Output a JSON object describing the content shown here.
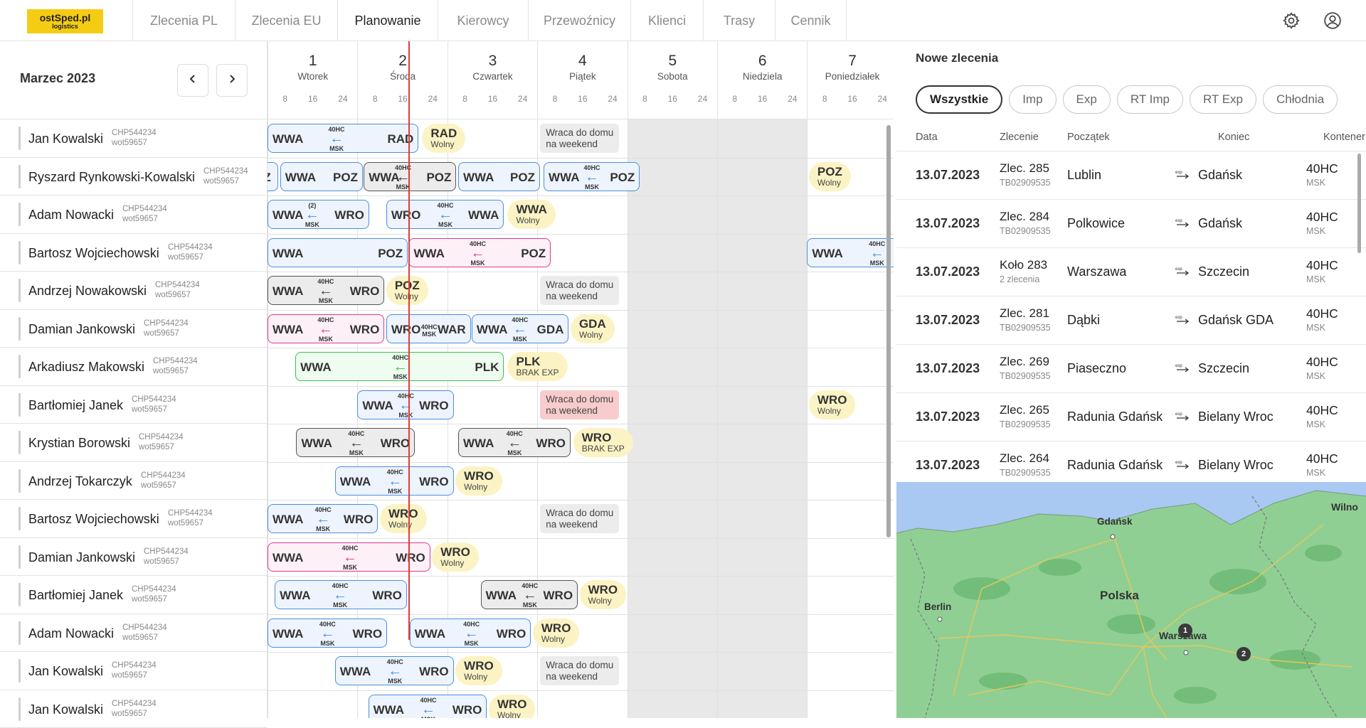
{
  "logo": {
    "line1": "ostSped.pl",
    "line2": "logistics"
  },
  "nav": [
    {
      "label": "Zlecenia PL",
      "w": 144
    },
    {
      "label": "Zlecenia EU",
      "w": 144
    },
    {
      "label": "Planowanie",
      "w": 141
    },
    {
      "label": "Kierowcy",
      "w": 127
    },
    {
      "label": "Przewoźnicy",
      "w": 144
    },
    {
      "label": "Klienci",
      "w": 102
    },
    {
      "label": "Trasy",
      "w": 101
    },
    {
      "label": "Cennik",
      "w": 101
    }
  ],
  "nav_active": "Planowanie",
  "calendar": {
    "month": "Marzec 2023",
    "hours": [
      "8",
      "16",
      "24"
    ],
    "days": [
      {
        "num": "1",
        "name": "Wtorek"
      },
      {
        "num": "2",
        "name": "Środa"
      },
      {
        "num": "3",
        "name": "Czwartek"
      },
      {
        "num": "4",
        "name": "Piątek"
      },
      {
        "num": "5",
        "name": "Sobota"
      },
      {
        "num": "6",
        "name": "Niedziela"
      },
      {
        "num": "7",
        "name": "Poniedziałek"
      }
    ]
  },
  "drivers": [
    {
      "name": "Jan Kowalski",
      "code": "CHP544234",
      "id": "wot59657"
    },
    {
      "name": "Ryszard Rynkowski-Kowalski",
      "code": "CHP544234",
      "id": "wot59657"
    },
    {
      "name": "Adam Nowacki",
      "code": "CHP544234",
      "id": "wot59657"
    },
    {
      "name": "Bartosz Wojciechowski",
      "code": "CHP544234",
      "id": "wot59657"
    },
    {
      "name": "Andrzej Nowakowski",
      "code": "CHP544234",
      "id": "wot59657"
    },
    {
      "name": "Damian Jankowski",
      "code": "CHP544234",
      "id": "wot59657"
    },
    {
      "name": "Arkadiusz Makowski",
      "code": "CHP544234",
      "id": "wot59657"
    },
    {
      "name": "Bartłomiej Janek",
      "code": "CHP544234",
      "id": "wot59657"
    },
    {
      "name": "Krystian Borowski",
      "code": "CHP544234",
      "id": "wot59657"
    },
    {
      "name": "Andrzej Tokarczyk",
      "code": "CHP544234",
      "id": "wot59657"
    },
    {
      "name": "Bartosz Wojciechowski",
      "code": "CHP544234",
      "id": "wot59657"
    },
    {
      "name": "Damian Jankowski",
      "code": "CHP544234",
      "id": "wot59657"
    },
    {
      "name": "Bartłomiej Janek",
      "code": "CHP544234",
      "id": "wot59657"
    },
    {
      "name": "Adam Nowacki",
      "code": "CHP544234",
      "id": "wot59657"
    },
    {
      "name": "Jan Kowalski",
      "code": "CHP544234",
      "id": "wot59657"
    },
    {
      "name": "Jan Kowalski",
      "code": "CHP544234",
      "id": "wot59657"
    }
  ],
  "trip_labels": {
    "container": "40HC",
    "sub": "MSK",
    "count2": "(2)"
  },
  "trips": [
    {
      "row": 0,
      "from": "WWA",
      "to": "RAD",
      "c": "blue",
      "s": 0,
      "e": 1.68,
      "m": 0.76
    },
    {
      "row": 1,
      "from": "Z",
      "to": "",
      "c": "blue",
      "s": -0.1,
      "e": 0.12,
      "m": -1
    },
    {
      "row": 1,
      "from": "WWA",
      "to": "POZ",
      "c": "blue",
      "s": 0.14,
      "e": 1.06,
      "m": -1
    },
    {
      "row": 1,
      "from": "WWA",
      "to": "POZ",
      "c": "gray",
      "s": 1.07,
      "e": 2.1,
      "m": 1.5
    },
    {
      "row": 1,
      "from": "WWA",
      "to": "POZ",
      "c": "blue",
      "s": 2.12,
      "e": 3.03,
      "m": -1
    },
    {
      "row": 1,
      "from": "WWA",
      "to": "POZ",
      "c": "blue",
      "s": 3.07,
      "e": 4.14,
      "m": 3.6
    },
    {
      "row": 2,
      "from": "WWA",
      "to": "WRO",
      "c": "blue",
      "s": 0,
      "e": 1.13,
      "m": 0.49,
      "cnt": true
    },
    {
      "row": 2,
      "from": "WRO",
      "to": "WWA",
      "c": "blue",
      "s": 1.32,
      "e": 2.63,
      "m": 1.97
    },
    {
      "row": 3,
      "from": "WWA",
      "to": "POZ",
      "c": "blue",
      "s": 0,
      "e": 1.56,
      "m": -1
    },
    {
      "row": 3,
      "from": "WWA",
      "to": "POZ",
      "c": "pink",
      "s": 1.57,
      "e": 3.15,
      "m": 2.33
    },
    {
      "row": 3,
      "from": "WWA",
      "to": "",
      "c": "blue",
      "s": 6.0,
      "e": 7.3,
      "m": 6.77
    },
    {
      "row": 4,
      "from": "WWA",
      "to": "WRO",
      "c": "gray",
      "s": 0,
      "e": 1.3,
      "m": 0.64
    },
    {
      "row": 5,
      "from": "WWA",
      "to": "WRO",
      "c": "pink",
      "s": 0,
      "e": 1.3,
      "m": 0.64
    },
    {
      "row": 5,
      "from": "WRO",
      "to": "WAR",
      "c": "blue",
      "s": 1.32,
      "e": 2.26,
      "m": 1.79,
      "plain": true
    },
    {
      "row": 5,
      "from": "WWA",
      "to": "GDA",
      "c": "blue",
      "s": 2.27,
      "e": 3.35,
      "m": 2.8
    },
    {
      "row": 6,
      "from": "WWA",
      "to": "PLK",
      "c": "green",
      "s": 0.31,
      "e": 2.63,
      "m": 1.47
    },
    {
      "row": 7,
      "from": "WWA",
      "to": "WRO",
      "c": "blue",
      "s": 1.0,
      "e": 2.07,
      "m": 1.53
    },
    {
      "row": 8,
      "from": "WWA",
      "to": "WRO",
      "c": "gray",
      "s": 0.32,
      "e": 1.64,
      "m": 0.98
    },
    {
      "row": 8,
      "from": "WWA",
      "to": "WRO",
      "c": "gray",
      "s": 2.12,
      "e": 3.37,
      "m": 2.74
    },
    {
      "row": 9,
      "from": "WWA",
      "to": "WRO",
      "c": "blue",
      "s": 0.75,
      "e": 2.07,
      "m": 1.41
    },
    {
      "row": 10,
      "from": "WWA",
      "to": "WRO",
      "c": "blue",
      "s": 0,
      "e": 1.23,
      "m": 0.61
    },
    {
      "row": 11,
      "from": "WWA",
      "to": "WRO",
      "c": "pink",
      "s": 0,
      "e": 1.81,
      "m": 0.91
    },
    {
      "row": 12,
      "from": "WWA",
      "to": "WRO",
      "c": "blue",
      "s": 0.08,
      "e": 1.55,
      "m": 0.8
    },
    {
      "row": 12,
      "from": "WWA",
      "to": "WRO",
      "c": "gray",
      "s": 2.37,
      "e": 3.45,
      "m": 2.91
    },
    {
      "row": 13,
      "from": "WWA",
      "to": "WRO",
      "c": "blue",
      "s": 0,
      "e": 1.33,
      "m": 0.66
    },
    {
      "row": 13,
      "from": "WWA",
      "to": "WRO",
      "c": "blue",
      "s": 1.58,
      "e": 2.93,
      "m": 2.26
    },
    {
      "row": 14,
      "from": "WWA",
      "to": "WRO",
      "c": "blue",
      "s": 0.75,
      "e": 2.07,
      "m": 1.41
    },
    {
      "row": 15,
      "from": "WWA",
      "to": "WRO",
      "c": "blue",
      "s": 1.12,
      "e": 2.44,
      "m": 1.78
    }
  ],
  "free_slots": [
    {
      "row": 0,
      "city": "RAD",
      "status": "Wolny",
      "s": 1.72
    },
    {
      "row": 1,
      "city": "POZ",
      "status": "Wolny",
      "s": 6.02
    },
    {
      "row": 2,
      "city": "WWA",
      "status": "Wolny",
      "s": 2.67
    },
    {
      "row": 4,
      "city": "POZ",
      "status": "Wolny",
      "s": 1.32
    },
    {
      "row": 5,
      "city": "GDA",
      "status": "Wolny",
      "s": 3.37
    },
    {
      "row": 6,
      "city": "PLK",
      "status": "BRAK EXP",
      "s": 2.67
    },
    {
      "row": 7,
      "city": "WRO",
      "status": "Wolny",
      "s": 6.02
    },
    {
      "row": 8,
      "city": "WRO",
      "status": "BRAK EXP",
      "s": 3.4
    },
    {
      "row": 9,
      "city": "WRO",
      "status": "Wolny",
      "s": 2.09
    },
    {
      "row": 10,
      "city": "WRO",
      "status": "Wolny",
      "s": 1.25
    },
    {
      "row": 11,
      "city": "WRO",
      "status": "Wolny",
      "s": 1.83
    },
    {
      "row": 12,
      "city": "WRO",
      "status": "Wolny",
      "s": 3.47
    },
    {
      "row": 13,
      "city": "WRO",
      "status": "Wolny",
      "s": 2.95
    },
    {
      "row": 14,
      "city": "WRO",
      "status": "Wolny",
      "s": 2.09
    },
    {
      "row": 15,
      "city": "WRO",
      "status": "Wolny",
      "s": 2.46
    }
  ],
  "weekend_notes": [
    {
      "row": 0,
      "text1": "Wraca do domu",
      "text2": "na weekend",
      "red": false
    },
    {
      "row": 4,
      "text1": "Wraca do domu",
      "text2": "na weekend",
      "red": false
    },
    {
      "row": 7,
      "text1": "Wraca do domu",
      "text2": "na weekend",
      "red": true
    },
    {
      "row": 10,
      "text1": "Wraca do domu",
      "text2": "na weekend",
      "red": false
    },
    {
      "row": 14,
      "text1": "Wraca do domu",
      "text2": "na weekend",
      "red": false
    }
  ],
  "panel": {
    "title": "Nowe zlecenia",
    "filters": [
      "Wszystkie",
      "Imp",
      "Exp",
      "RT Imp",
      "RT Exp",
      "Chłodnia"
    ],
    "filter_active": "Wszystkie",
    "columns": {
      "data": "Data",
      "zlecenie": "Zlecenie",
      "poczatek": "Początek",
      "koniec": "Koniec",
      "kontener": "Kontener"
    },
    "exp_icon": "exp",
    "orders": [
      {
        "date": "13.07.2023",
        "title": "Zlec. 285",
        "sub": "TB02909535",
        "from": "Lublin",
        "to": "Gdańsk",
        "cont": "40HC",
        "cont_sub": "MSK"
      },
      {
        "date": "13.07.2023",
        "title": "Zlec. 284",
        "sub": "TB02909535",
        "from": "Polkowice",
        "to": "Gdańsk",
        "cont": "40HC",
        "cont_sub": "MSK"
      },
      {
        "date": "13.07.2023",
        "title": "Koło 283",
        "sub": "2 zlecenia",
        "from": "Warszawa",
        "to": "Szczecin",
        "cont": "40HC",
        "cont_sub": "MSK"
      },
      {
        "date": "13.07.2023",
        "title": "Zlec. 281",
        "sub": "TB02909535",
        "from": "Dąbki",
        "to": "Gdańsk GDA",
        "cont": "40HC",
        "cont_sub": "MSK"
      },
      {
        "date": "13.07.2023",
        "title": "Zlec. 269",
        "sub": "TB02909535",
        "from": "Piaseczno",
        "to": "Szczecin",
        "cont": "40HC",
        "cont_sub": "MSK"
      },
      {
        "date": "13.07.2023",
        "title": "Zlec. 265",
        "sub": "TB02909535",
        "from": "Radunia Gdańsk",
        "to": "Bielany Wroc",
        "cont": "40HC",
        "cont_sub": "MSK"
      },
      {
        "date": "13.07.2023",
        "title": "Zlec. 264",
        "sub": "TB02909535",
        "from": "Radunia Gdańsk",
        "to": "Bielany Wroc",
        "cont": "40HC",
        "cont_sub": "MSK"
      }
    ]
  },
  "map": {
    "cities": [
      "Gdańsk",
      "Berlin",
      "Polska",
      "Warszawa",
      "Wilno"
    ],
    "badges": [
      "1",
      "2"
    ]
  }
}
